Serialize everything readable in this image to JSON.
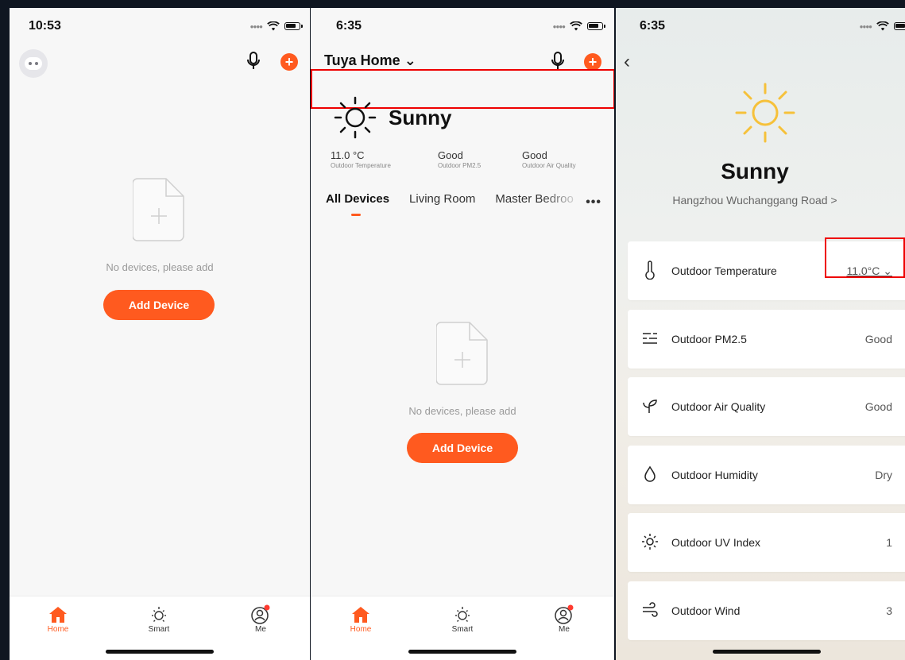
{
  "screen1": {
    "time": "10:53",
    "empty_text": "No devices, please add",
    "add_button": "Add Device",
    "tabs": [
      {
        "label": "Home"
      },
      {
        "label": "Smart"
      },
      {
        "label": "Me"
      }
    ]
  },
  "screen2": {
    "time": "6:35",
    "home_name": "Tuya Home",
    "chevron": "⌄",
    "weather": {
      "condition": "Sunny",
      "icon": "sun-icon"
    },
    "metrics": [
      {
        "value": "11.0 °C",
        "label": "Outdoor Temperature"
      },
      {
        "value": "Good",
        "label": "Outdoor PM2.5"
      },
      {
        "value": "Good",
        "label": "Outdoor Air Quality"
      }
    ],
    "rooms": [
      "All Devices",
      "Living Room",
      "Master Bedroo"
    ],
    "more": "•••",
    "empty_text": "No devices, please add",
    "add_button": "Add Device",
    "tabs": [
      {
        "label": "Home"
      },
      {
        "label": "Smart"
      },
      {
        "label": "Me"
      }
    ]
  },
  "screen3": {
    "time": "6:35",
    "back": "‹",
    "condition": "Sunny",
    "location": "Hangzhou Wuchanggang Road >",
    "items": [
      {
        "label": "Outdoor Temperature",
        "value": "11.0°C ⌄",
        "icon": "thermometer-icon"
      },
      {
        "label": "Outdoor PM2.5",
        "value": "Good",
        "icon": "pm25-icon"
      },
      {
        "label": "Outdoor Air Quality",
        "value": "Good",
        "icon": "leaf-icon"
      },
      {
        "label": "Outdoor Humidity",
        "value": "Dry",
        "icon": "droplet-icon"
      },
      {
        "label": "Outdoor UV Index",
        "value": "1",
        "icon": "uv-icon"
      },
      {
        "label": "Outdoor Wind",
        "value": "3",
        "icon": "wind-icon"
      }
    ]
  },
  "colors": {
    "accent": "#ff5a1f",
    "highlight": "#e00000",
    "background": "#0f1621"
  }
}
